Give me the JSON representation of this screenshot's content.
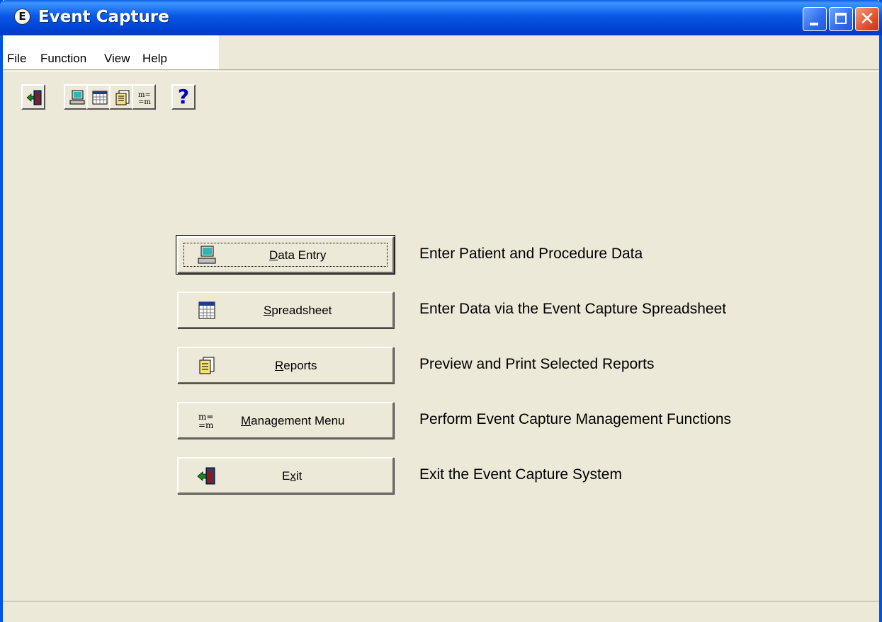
{
  "window": {
    "title": "Event Capture",
    "app_icon_letter": "E"
  },
  "menu": [
    {
      "label": "File"
    },
    {
      "label": "Function"
    },
    {
      "label": "View"
    },
    {
      "label": "Help"
    }
  ],
  "toolbar": [
    {
      "icon": "exit-icon"
    },
    {
      "icon": "data-entry-icon"
    },
    {
      "icon": "spreadsheet-icon"
    },
    {
      "icon": "reports-icon"
    },
    {
      "icon": "management-menu-icon"
    },
    {
      "icon": "help-icon",
      "glyph": "?"
    }
  ],
  "actions": [
    {
      "pre": "",
      "accel": "D",
      "post": "ata Entry",
      "description": "Enter Patient and Procedure Data",
      "icon": "data-entry-icon"
    },
    {
      "pre": "",
      "accel": "S",
      "post": "preadsheet",
      "description": "Enter Data via the Event Capture Spreadsheet",
      "icon": "spreadsheet-icon"
    },
    {
      "pre": "",
      "accel": "R",
      "post": "eports",
      "description": "Preview and Print Selected Reports",
      "icon": "reports-icon"
    },
    {
      "pre": "",
      "accel": "M",
      "post": "anagement Menu",
      "description": "Perform Event Capture Management Functions",
      "icon": "management-menu-icon"
    },
    {
      "pre": "E",
      "accel": "x",
      "post": "it",
      "description": "Exit the Event Capture System",
      "icon": "exit-icon"
    }
  ],
  "icon_text": {
    "management": "m=\n=m"
  }
}
